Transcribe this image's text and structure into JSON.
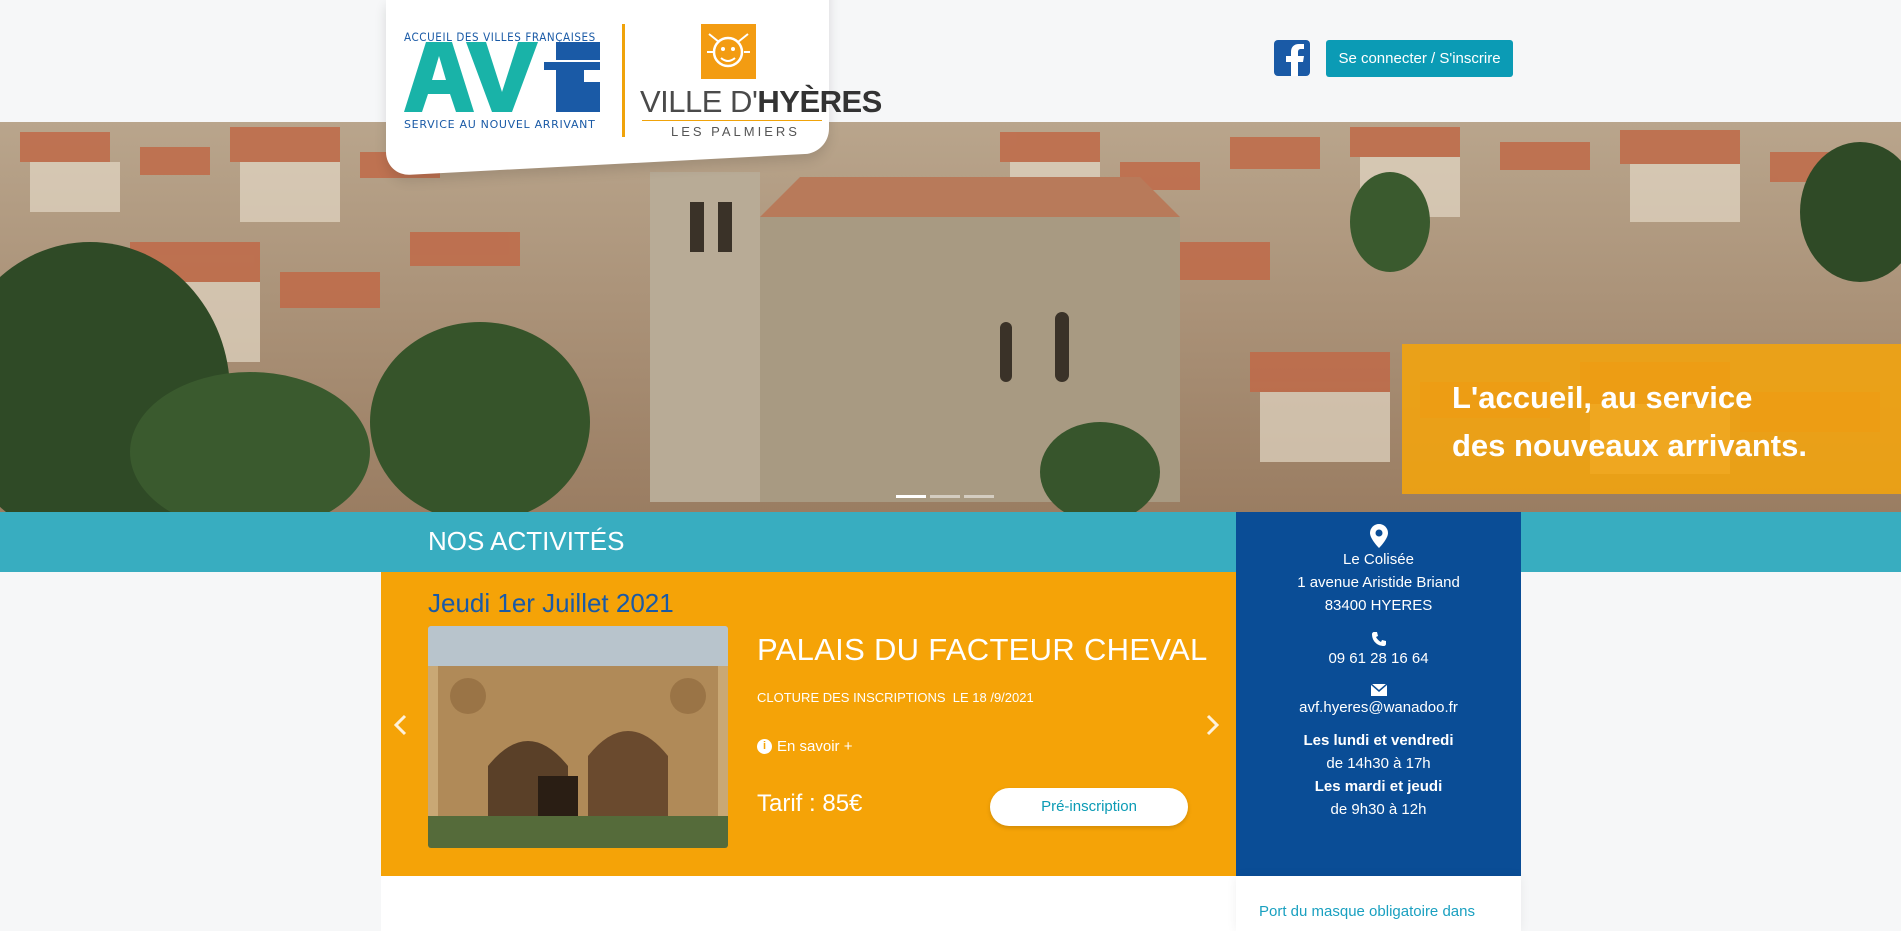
{
  "header": {
    "avf_top": "ACCUEIL DES VILLES FRANÇAISES",
    "avf_logo": "AVf",
    "avf_bottom": "SERVICE AU NOUVEL ARRIVANT",
    "ville_prefix": "VILLE D'",
    "ville_name": "HYÈRES",
    "ville_sub": "LES PALMIERS",
    "connect_label": "Se connecter / S'inscrire"
  },
  "hero": {
    "line1": "L'accueil, au service",
    "line2": "des nouveaux arrivants."
  },
  "activities": {
    "section_title": "NOS ACTIVITÉS",
    "date": "Jeudi 1er Juillet 2021",
    "title": "PALAIS DU FACTEUR CHEVAL",
    "deadline": "CLOTURE DES INSCRIPTIONS  LE 18 /9/2021",
    "more_label": "En savoir +",
    "price": "Tarif : 85€",
    "preinscription_label": "Pré-inscription"
  },
  "contact": {
    "place": "Le Colisée",
    "address": "1 avenue Aristide Briand",
    "city": "83400 HYERES",
    "phone": "09 61 28 16 64",
    "email": "avf.hyeres@wanadoo.fr",
    "hours_1_days": "Les lundi et vendredi",
    "hours_1_time": "de 14h30 à 17h",
    "hours_2_days": "Les mardi et jeudi",
    "hours_2_time": "de 9h30 à 12h"
  },
  "notice": {
    "text": "Port du masque obligatoire dans"
  },
  "colors": {
    "teal": "#0b9bb5",
    "orange": "#f5a307",
    "navy": "#0a4d96",
    "brand_blue": "#1a5aa6"
  }
}
